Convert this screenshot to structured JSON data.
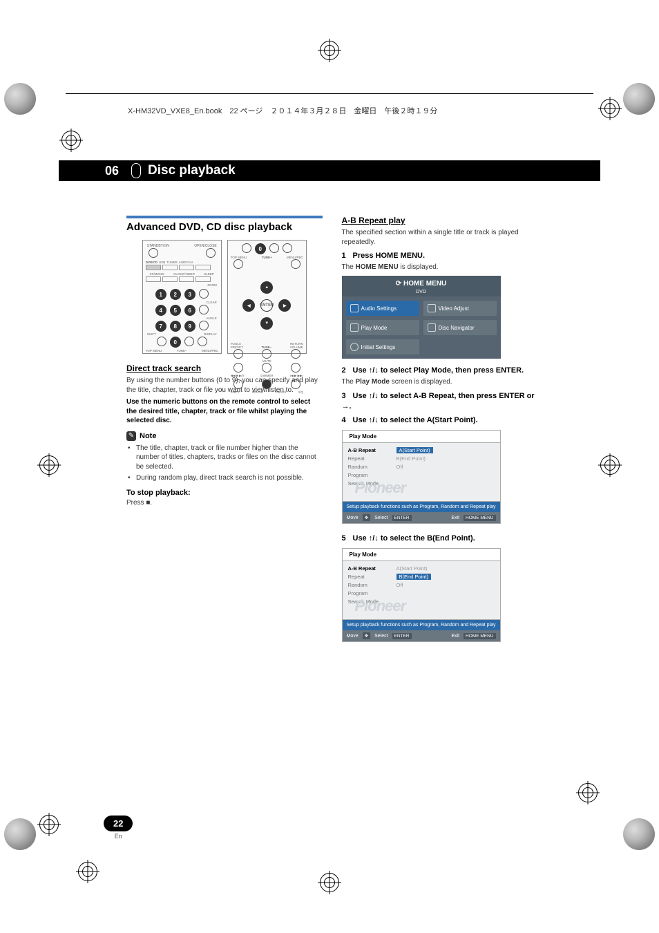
{
  "header": {
    "book_line": "X-HM32VD_VXE8_En.book　22 ページ　２０１４年３月２８日　金曜日　午後２時１９分"
  },
  "chapter": {
    "number": "06",
    "title": "Disc playback"
  },
  "left": {
    "h2": "Advanced DVD, CD disc playback",
    "direct_track": {
      "heading": "Direct track search",
      "p1": "By using the number buttons (0 to 9), you can specify and play the title, chapter, track or file you want to view/listen to.",
      "p2": "Use the numeric buttons on the remote control to select the desired title, chapter, track or file whilst playing the selected disc.",
      "note_label": "Note",
      "note1": "The title, chapter, track or file number higher than the number of titles, chapters, tracks or files on the disc cannot be selected.",
      "note2": "During random play, direct track search is not possible.",
      "stop_h": "To stop playback:",
      "stop_p": "Press ■."
    },
    "remote": {
      "left_labels": {
        "standby": "STANDBY/ON",
        "openclose": "OPEN/CLOSE",
        "dvdcd": "DVD/CD",
        "usb": "USB",
        "tuner": "TUNER",
        "aux": "AUDIO IN",
        "sta": "ST/MONO",
        "clock": "CLOCK/TIMER",
        "sleep": "SLEEP",
        "zoom": "ZOOM",
        "clear": "CLEAR",
        "shift": "SHIFT",
        "angle": "ANGLE",
        "display": "DISPLAY",
        "topmenu": "TOP MENU",
        "tune": "TUNE–",
        "menu": "MENU/PBC"
      },
      "right_labels": {
        "topmenu": "TOP MENU",
        "tuneup": "TUNE+",
        "menu": "MENU/PBC",
        "enter": "ENTER",
        "preset": "PRESET",
        "tunedown": "TUNE–",
        "volume": "VOLUME",
        "mute": "MUTE",
        "eq": "EQ",
        "pbass": "P.BASS",
        "return": "RETURN",
        "tools": "TOOLS",
        "shift": "SHIFT",
        "dimmer": "DIMMER",
        "sound": "SOUND"
      }
    }
  },
  "right": {
    "ab": {
      "heading": "A-B Repeat play",
      "p1": "The specified section within a single title or track is played repeatedly.",
      "s1": "Press HOME MENU.",
      "s1b_pre": "The ",
      "s1b_bold": "HOME MENU",
      "s1b_post": " is displayed.",
      "hm": {
        "title": "HOME MENU",
        "sub": "DVD",
        "c1": "Audio Settings",
        "c2": "Video Adjust",
        "c3": "Play Mode",
        "c4": "Disc Navigator",
        "c5": "Initial Settings"
      },
      "s2a": "Use ",
      "s2b": " to select Play Mode, then press ENTER.",
      "s2c_pre": "The ",
      "s2c_bold": "Play Mode",
      "s2c_post": " screen is displayed.",
      "s3a": "Use ",
      "s3b": " to select A-B Repeat, then press ENTER or ",
      "s3c": ".",
      "s4a": "Use ",
      "s4b": " to select the A(Start Point).",
      "s5a": "Use ",
      "s5b": " to select the B(End Point).",
      "pm_title": "Play Mode",
      "pm_items": [
        "A-B Repeat",
        "Repeat",
        "Random",
        "Program",
        "Search Mode"
      ],
      "pm_opts": [
        "A(Start Point)",
        "B(End Point)",
        "Off"
      ],
      "pm_msg1": "Setup playback functions such as Program, Random and Repeat play",
      "pm_foot_move": "Move",
      "pm_foot_select": "Select",
      "pm_foot_enter": "ENTER",
      "pm_foot_exit": "Exit",
      "pm_foot_home": "HOME MENU",
      "wm": "Pioneer"
    }
  },
  "page": {
    "num": "22",
    "lang": "En"
  }
}
